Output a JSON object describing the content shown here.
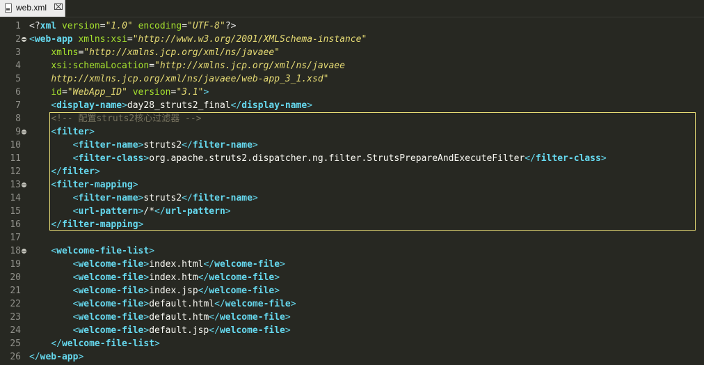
{
  "tab": {
    "label": "web.xml",
    "close_glyph": "⌧"
  },
  "line_numbers": [
    "1",
    "2",
    "3",
    "4",
    "5",
    "6",
    "7",
    "8",
    "9",
    "10",
    "11",
    "12",
    "13",
    "14",
    "15",
    "16",
    "17",
    "18",
    "19",
    "20",
    "21",
    "22",
    "23",
    "24",
    "25",
    "26"
  ],
  "fold_lines": [
    2,
    9,
    13,
    18
  ],
  "highlight": {
    "from_line": 8,
    "to_line": 16,
    "color": "#e6db74"
  },
  "colors": {
    "background": "#272822",
    "tag": "#66d9ef",
    "attribute": "#a6e22e",
    "string": "#e6db74",
    "comment": "#75715e",
    "text": "#f8f8f2",
    "line_number": "#90908a"
  },
  "lines": [
    [
      [
        "pi",
        "<?"
      ],
      [
        "pk",
        "xml"
      ],
      [
        "sp",
        " "
      ],
      [
        "attr",
        "version"
      ],
      [
        "eq",
        "="
      ],
      [
        "str",
        "\"1.0\""
      ],
      [
        "sp",
        " "
      ],
      [
        "attr",
        "encoding"
      ],
      [
        "eq",
        "="
      ],
      [
        "str",
        "\"UTF-8\""
      ],
      [
        "pi",
        "?>"
      ]
    ],
    [
      [
        "br",
        "<"
      ],
      [
        "tag",
        "web-app"
      ],
      [
        "sp",
        " "
      ],
      [
        "attr",
        "xmlns:xsi"
      ],
      [
        "eq",
        "="
      ],
      [
        "str",
        "\"http://www.w3.org/2001/XMLSchema-instance\""
      ]
    ],
    [
      [
        "sp",
        "    "
      ],
      [
        "attr",
        "xmlns"
      ],
      [
        "eq",
        "="
      ],
      [
        "str",
        "\"http://xmlns.jcp.org/xml/ns/javaee\""
      ]
    ],
    [
      [
        "sp",
        "    "
      ],
      [
        "attr",
        "xsi:schemaLocation"
      ],
      [
        "eq",
        "="
      ],
      [
        "str",
        "\"http://xmlns.jcp.org/xml/ns/javaee"
      ]
    ],
    [
      [
        "sp",
        "    "
      ],
      [
        "str",
        "http://xmlns.jcp.org/xml/ns/javaee/web-app_3_1.xsd\""
      ]
    ],
    [
      [
        "sp",
        "    "
      ],
      [
        "attr",
        "id"
      ],
      [
        "eq",
        "="
      ],
      [
        "str",
        "\"WebApp_ID\""
      ],
      [
        "sp",
        " "
      ],
      [
        "attr",
        "version"
      ],
      [
        "eq",
        "="
      ],
      [
        "str",
        "\"3.1\""
      ],
      [
        "br",
        ">"
      ]
    ],
    [
      [
        "sp",
        "    "
      ],
      [
        "br",
        "<"
      ],
      [
        "tag",
        "display-name"
      ],
      [
        "br",
        ">"
      ],
      [
        "txt",
        "day28_struts2_final"
      ],
      [
        "br",
        "</"
      ],
      [
        "tag",
        "display-name"
      ],
      [
        "br",
        ">"
      ]
    ],
    [
      [
        "sp",
        "    "
      ],
      [
        "cmt",
        "<!-- 配置struts2核心过滤器 -->"
      ]
    ],
    [
      [
        "sp",
        "    "
      ],
      [
        "br",
        "<"
      ],
      [
        "tag",
        "filter"
      ],
      [
        "br",
        ">"
      ]
    ],
    [
      [
        "sp",
        "        "
      ],
      [
        "br",
        "<"
      ],
      [
        "tag",
        "filter-name"
      ],
      [
        "br",
        ">"
      ],
      [
        "txt",
        "struts2"
      ],
      [
        "br",
        "</"
      ],
      [
        "tag",
        "filter-name"
      ],
      [
        "br",
        ">"
      ]
    ],
    [
      [
        "sp",
        "        "
      ],
      [
        "br",
        "<"
      ],
      [
        "tag",
        "filter-class"
      ],
      [
        "br",
        ">"
      ],
      [
        "txt",
        "org.apache.struts2.dispatcher.ng.filter.StrutsPrepareAndExecuteFilter"
      ],
      [
        "br",
        "</"
      ],
      [
        "tag",
        "filter-class"
      ],
      [
        "br",
        ">"
      ]
    ],
    [
      [
        "sp",
        "    "
      ],
      [
        "br",
        "</"
      ],
      [
        "tag",
        "filter"
      ],
      [
        "br",
        ">"
      ]
    ],
    [
      [
        "sp",
        "    "
      ],
      [
        "br",
        "<"
      ],
      [
        "tag",
        "filter-mapping"
      ],
      [
        "br",
        ">"
      ]
    ],
    [
      [
        "sp",
        "        "
      ],
      [
        "br",
        "<"
      ],
      [
        "tag",
        "filter-name"
      ],
      [
        "br",
        ">"
      ],
      [
        "txt",
        "struts2"
      ],
      [
        "br",
        "</"
      ],
      [
        "tag",
        "filter-name"
      ],
      [
        "br",
        ">"
      ]
    ],
    [
      [
        "sp",
        "        "
      ],
      [
        "br",
        "<"
      ],
      [
        "tag",
        "url-pattern"
      ],
      [
        "br",
        ">"
      ],
      [
        "txt",
        "/*"
      ],
      [
        "br",
        "</"
      ],
      [
        "tag",
        "url-pattern"
      ],
      [
        "br",
        ">"
      ]
    ],
    [
      [
        "sp",
        "    "
      ],
      [
        "br",
        "</"
      ],
      [
        "tag",
        "filter-mapping"
      ],
      [
        "br",
        ">"
      ]
    ],
    [],
    [
      [
        "sp",
        "    "
      ],
      [
        "br",
        "<"
      ],
      [
        "tag",
        "welcome-file-list"
      ],
      [
        "br",
        ">"
      ]
    ],
    [
      [
        "sp",
        "        "
      ],
      [
        "br",
        "<"
      ],
      [
        "tag",
        "welcome-file"
      ],
      [
        "br",
        ">"
      ],
      [
        "txt",
        "index.html"
      ],
      [
        "br",
        "</"
      ],
      [
        "tag",
        "welcome-file"
      ],
      [
        "br",
        ">"
      ]
    ],
    [
      [
        "sp",
        "        "
      ],
      [
        "br",
        "<"
      ],
      [
        "tag",
        "welcome-file"
      ],
      [
        "br",
        ">"
      ],
      [
        "txt",
        "index.htm"
      ],
      [
        "br",
        "</"
      ],
      [
        "tag",
        "welcome-file"
      ],
      [
        "br",
        ">"
      ]
    ],
    [
      [
        "sp",
        "        "
      ],
      [
        "br",
        "<"
      ],
      [
        "tag",
        "welcome-file"
      ],
      [
        "br",
        ">"
      ],
      [
        "txt",
        "index.jsp"
      ],
      [
        "br",
        "</"
      ],
      [
        "tag",
        "welcome-file"
      ],
      [
        "br",
        ">"
      ]
    ],
    [
      [
        "sp",
        "        "
      ],
      [
        "br",
        "<"
      ],
      [
        "tag",
        "welcome-file"
      ],
      [
        "br",
        ">"
      ],
      [
        "txt",
        "default.html"
      ],
      [
        "br",
        "</"
      ],
      [
        "tag",
        "welcome-file"
      ],
      [
        "br",
        ">"
      ]
    ],
    [
      [
        "sp",
        "        "
      ],
      [
        "br",
        "<"
      ],
      [
        "tag",
        "welcome-file"
      ],
      [
        "br",
        ">"
      ],
      [
        "txt",
        "default.htm"
      ],
      [
        "br",
        "</"
      ],
      [
        "tag",
        "welcome-file"
      ],
      [
        "br",
        ">"
      ]
    ],
    [
      [
        "sp",
        "        "
      ],
      [
        "br",
        "<"
      ],
      [
        "tag",
        "welcome-file"
      ],
      [
        "br",
        ">"
      ],
      [
        "txt",
        "default.jsp"
      ],
      [
        "br",
        "</"
      ],
      [
        "tag",
        "welcome-file"
      ],
      [
        "br",
        ">"
      ]
    ],
    [
      [
        "sp",
        "    "
      ],
      [
        "br",
        "</"
      ],
      [
        "tag",
        "welcome-file-list"
      ],
      [
        "br",
        ">"
      ]
    ],
    [
      [
        "br",
        "</"
      ],
      [
        "tag",
        "web-app"
      ],
      [
        "br",
        ">"
      ]
    ]
  ]
}
